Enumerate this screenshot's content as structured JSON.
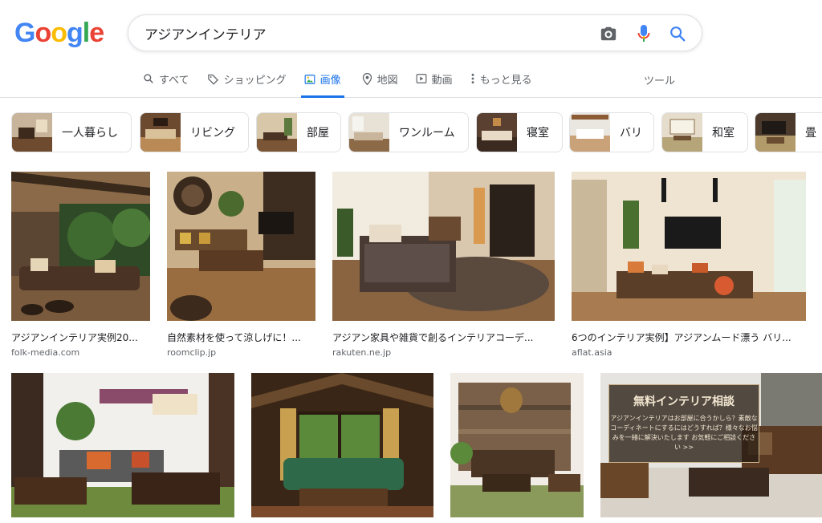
{
  "logo": {
    "letters": [
      "G",
      "o",
      "o",
      "g",
      "l",
      "e"
    ],
    "colors": [
      "#4285f4",
      "#ea4335",
      "#fbbc05",
      "#4285f4",
      "#34a853",
      "#ea4335"
    ]
  },
  "search": {
    "query": "アジアンインテリア",
    "icons": [
      "camera-icon",
      "mic-icon",
      "search-icon"
    ]
  },
  "tabs": [
    {
      "label": "すべて",
      "icon": "search-icon"
    },
    {
      "label": "ショッピング",
      "icon": "tag-icon"
    },
    {
      "label": "画像",
      "icon": "image-icon",
      "active": true
    },
    {
      "label": "地図",
      "icon": "map-pin-icon"
    },
    {
      "label": "動画",
      "icon": "play-icon"
    },
    {
      "label": "もっと見る",
      "icon": "more-vert-icon"
    }
  ],
  "tools_label": "ツール",
  "chips": [
    {
      "label": "一人暮らし"
    },
    {
      "label": "リビング"
    },
    {
      "label": "部屋"
    },
    {
      "label": "ワンルーム"
    },
    {
      "label": "寝室"
    },
    {
      "label": "バリ"
    },
    {
      "label": "和室"
    },
    {
      "label": "畳"
    }
  ],
  "results_row1": [
    {
      "title": "アジアンインテリア実例20...",
      "source": "folk-media.com"
    },
    {
      "title": "自然素材を使って涼しげに！...",
      "source": "roomclip.jp"
    },
    {
      "title": "アジアン家具や雑貨で創るインテリアコーデ...",
      "source": "rakuten.ne.jp"
    },
    {
      "title": "6つのインテリア実例】アジアンムード漂う バリ...",
      "source": "aflat.asia"
    }
  ],
  "overlay": {
    "title": "無料インテリア相談",
    "body": "アジアンインテリアはお部屋に合うかしら？素敵なコーディネートにするにはどうすれば？様々なお悩みを一緒に解決いたします お気軽にご相談ください >>"
  },
  "colors": {
    "accent": "#1a73e8"
  }
}
